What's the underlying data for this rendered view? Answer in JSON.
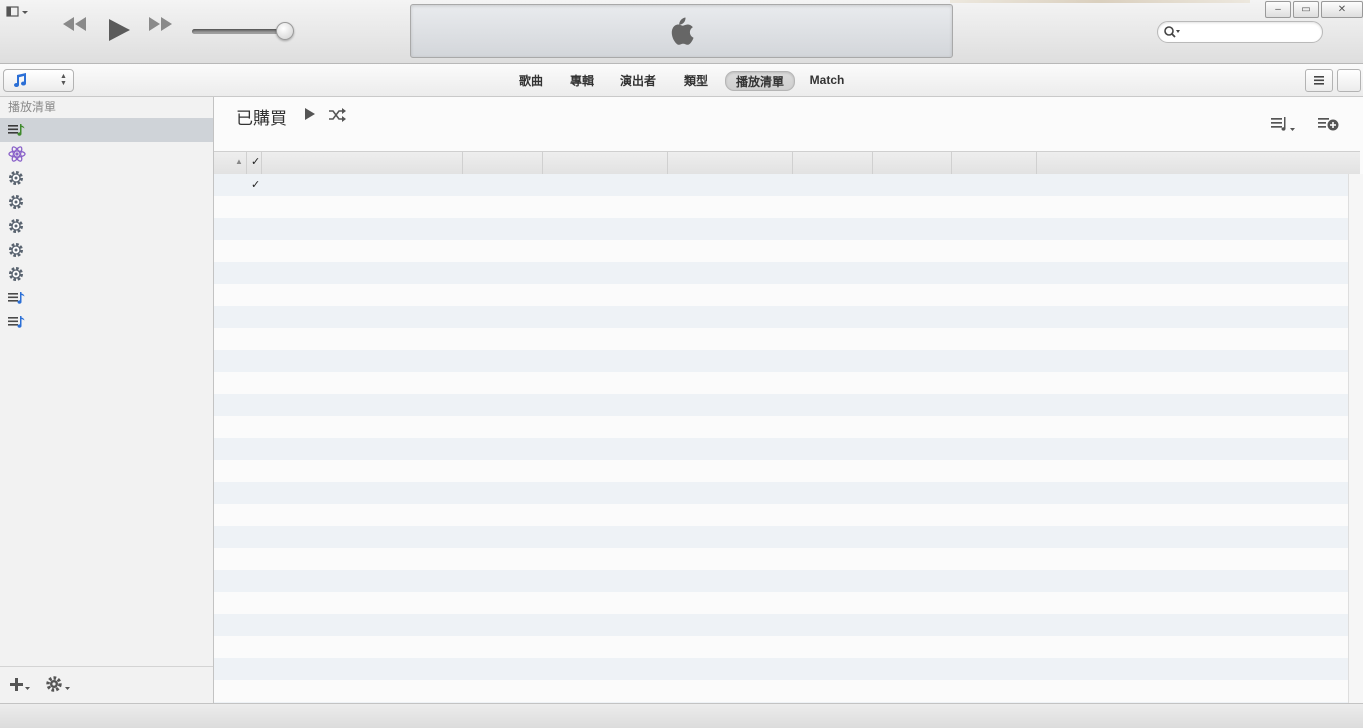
{
  "player": {
    "icons": [
      "sidebar-toggle-icon",
      "rewind-icon",
      "play-icon",
      "fast-forward-icon",
      "apple-logo-icon"
    ],
    "search": {
      "placeholder": "",
      "value": ""
    }
  },
  "window_controls": {
    "minimize": "–",
    "restore": "▭",
    "close": "✕"
  },
  "nav": {
    "media_type_icon": "music-note-icon",
    "tabs": [
      {
        "label": "歌曲",
        "active": false
      },
      {
        "label": "專輯",
        "active": false
      },
      {
        "label": "演出者",
        "active": false
      },
      {
        "label": "類型",
        "active": false
      },
      {
        "label": "播放清單",
        "active": true
      },
      {
        "label": "Match",
        "active": false
      }
    ]
  },
  "sidebar": {
    "header": "播放清單",
    "items": [
      {
        "icon": "playlist-green-icon",
        "selected": true
      },
      {
        "icon": "genius-atom-icon",
        "selected": false
      },
      {
        "icon": "smart-playlist-gear-icon",
        "selected": false
      },
      {
        "icon": "smart-playlist-gear-icon",
        "selected": false
      },
      {
        "icon": "smart-playlist-gear-icon",
        "selected": false
      },
      {
        "icon": "smart-playlist-gear-icon",
        "selected": false
      },
      {
        "icon": "smart-playlist-gear-icon",
        "selected": false
      },
      {
        "icon": "playlist-blue-icon",
        "selected": false
      },
      {
        "icon": "playlist-blue-icon",
        "selected": false
      }
    ],
    "footer_icons": [
      "add-icon",
      "settings-gear-icon"
    ]
  },
  "main": {
    "playlist_title": "已購買",
    "header_check": "✓",
    "sort_arrow": "▲",
    "rows": [
      {
        "checked": true,
        "check": "✓"
      }
    ],
    "empty_rows": 24
  },
  "colors": {
    "selected_row": "#cfd3d8",
    "stripe": "#eef2f6",
    "accent_blue": "#2b6fd6",
    "accent_green": "#3f8a2c"
  }
}
